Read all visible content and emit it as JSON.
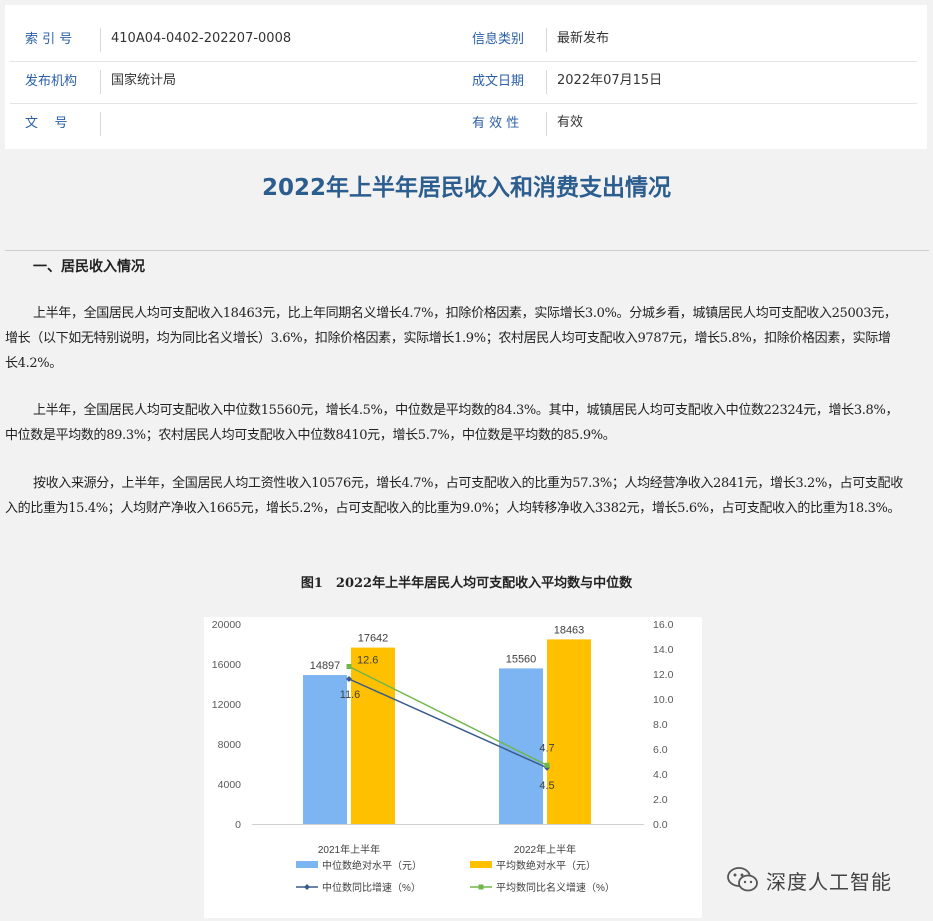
{
  "meta": {
    "rows": [
      {
        "label1": "索 引 号",
        "value1": "410A04-0402-202207-0008",
        "label2": "信息类别",
        "value2": "最新发布"
      },
      {
        "label1": "发布机构",
        "value1": "国家统计局",
        "label2": "成文日期",
        "value2": "2022年07月15日"
      },
      {
        "label1": "文    号",
        "value1": "",
        "label2": "有 效 性",
        "value2": "有效"
      }
    ]
  },
  "title": "2022年上半年居民收入和消费支出情况",
  "section1": {
    "heading": "一、居民收入情况",
    "paragraphs": [
      "上半年，全国居民人均可支配收入18463元，比上年同期名义增长4.7%，扣除价格因素，实际增长3.0%。分城乡看，城镇居民人均可支配收入25003元，增长（以下如无特别说明，均为同比名义增长）3.6%，扣除价格因素，实际增长1.9%；农村居民人均可支配收入9787元，增长5.8%，扣除价格因素，实际增长4.2%。",
      "上半年，全国居民人均可支配收入中位数15560元，增长4.5%，中位数是平均数的84.3%。其中，城镇居民人均可支配收入中位数22324元，增长3.8%，中位数是平均数的89.3%；农村居民人均可支配收入中位数8410元，增长5.7%，中位数是平均数的85.9%。",
      "按收入来源分，上半年，全国居民人均工资性收入10576元，增长4.7%，占可支配收入的比重为57.3%；人均经营净收入2841元，增长3.2%，占可支配收入的比重为15.4%；人均财产净收入1665元，增长5.2%，占可支配收入的比重为9.0%；人均转移净收入3382元，增长5.6%，占可支配收入的比重为18.3%。"
    ]
  },
  "figure": {
    "caption": "图1　2022年上半年居民人均可支配收入平均数与中位数"
  },
  "chart_data": {
    "type": "bar",
    "categories": [
      "2021年上半年",
      "2022年上半年"
    ],
    "series": [
      {
        "name": "中位数绝对水平（元）",
        "kind": "bar",
        "axis": "left",
        "color": "#7db5f3",
        "values": [
          14897,
          15560
        ]
      },
      {
        "name": "平均数绝对水平（元）",
        "kind": "bar",
        "axis": "left",
        "color": "#ffc000",
        "values": [
          17642,
          18463
        ]
      },
      {
        "name": "中位数同比增速（%）",
        "kind": "line",
        "axis": "right",
        "color": "#3a5a8c",
        "values": [
          11.6,
          4.5
        ]
      },
      {
        "name": "平均数同比名义增速（%）",
        "kind": "line",
        "axis": "right",
        "color": "#70b74a",
        "values": [
          12.6,
          4.7
        ]
      }
    ],
    "bar_labels": [
      "14897",
      "17642",
      "15560",
      "18463"
    ],
    "line_labels": [
      "11.6",
      "12.6",
      "4.5",
      "4.7"
    ],
    "y_left": {
      "range": [
        0,
        20000
      ],
      "ticks": [
        "0",
        "4000",
        "8000",
        "12000",
        "16000",
        "20000"
      ]
    },
    "y_right": {
      "range": [
        0,
        16
      ],
      "ticks": [
        "0.0",
        "2.0",
        "4.0",
        "6.0",
        "8.0",
        "10.0",
        "12.0",
        "14.0",
        "16.0"
      ]
    },
    "legend_position": "bottom",
    "grid": false
  },
  "watermark": {
    "text": "深度人工智能",
    "icon": "wechat-icon"
  }
}
